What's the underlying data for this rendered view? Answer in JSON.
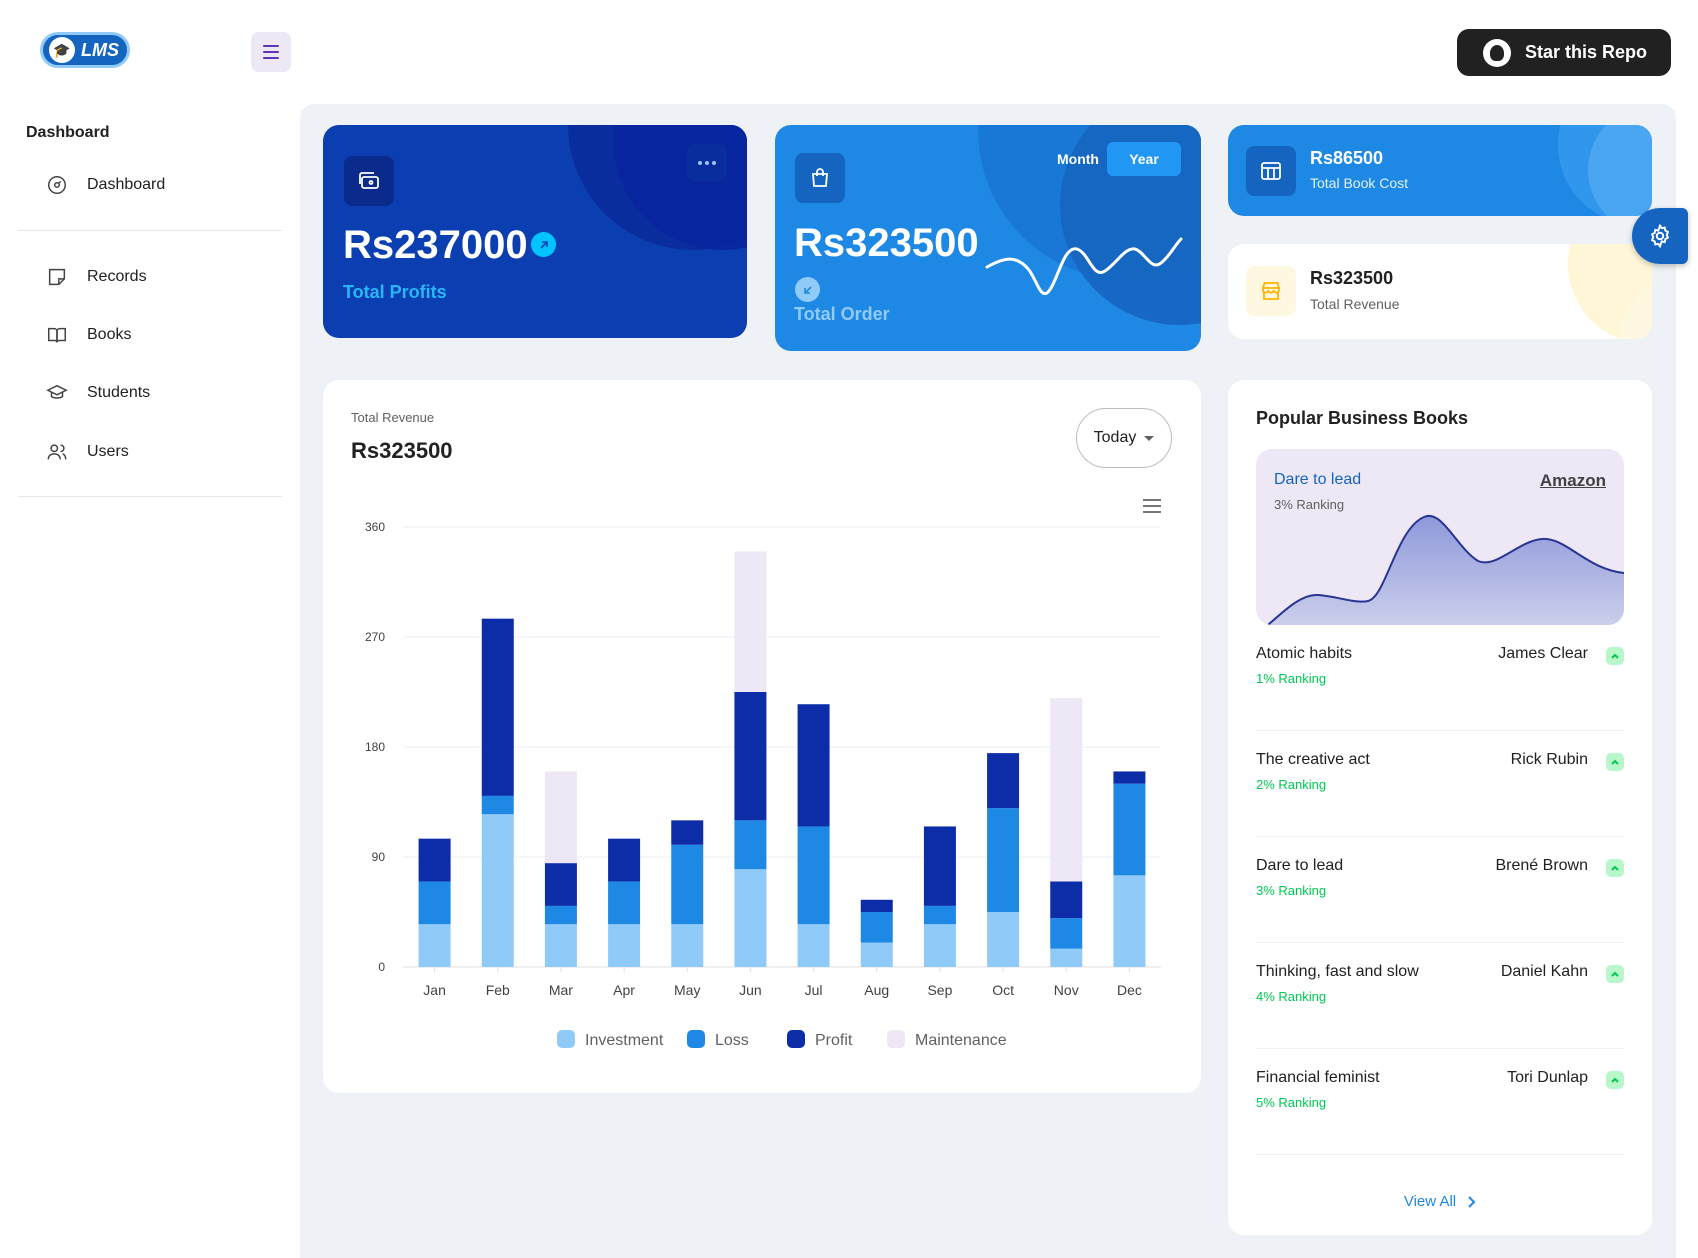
{
  "header": {
    "logo_text": "LMS",
    "star_label": "Star this Repo"
  },
  "sidebar": {
    "caption": "Dashboard",
    "items": [
      {
        "label": "Dashboard",
        "icon": "dashboard-icon"
      },
      {
        "label": "Records",
        "icon": "note-icon"
      },
      {
        "label": "Books",
        "icon": "book-icon"
      },
      {
        "label": "Students",
        "icon": "graduation-cap-icon"
      },
      {
        "label": "Users",
        "icon": "users-icon"
      }
    ]
  },
  "cards": {
    "profits": {
      "value": "Rs237000",
      "label": "Total Profits"
    },
    "orders": {
      "value": "Rs323500",
      "label": "Total Order",
      "toggle_month": "Month",
      "toggle_year": "Year",
      "toggle_selected": "Year"
    },
    "book_cost": {
      "value": "Rs86500",
      "label": "Total Book Cost"
    },
    "revenue": {
      "value": "Rs323500",
      "label": "Total Revenue"
    }
  },
  "revenue_panel": {
    "caption": "Total Revenue",
    "value": "Rs323500",
    "period_select": "Today"
  },
  "chart_data": {
    "type": "bar",
    "stacked": true,
    "categories": [
      "Jan",
      "Feb",
      "Mar",
      "Apr",
      "May",
      "Jun",
      "Jul",
      "Aug",
      "Sep",
      "Oct",
      "Nov",
      "Dec"
    ],
    "series": [
      {
        "name": "Investment",
        "color": "#90caf9",
        "values": [
          35,
          125,
          35,
          35,
          35,
          80,
          35,
          20,
          35,
          45,
          15,
          75
        ]
      },
      {
        "name": "Loss",
        "color": "#1e88e5",
        "values": [
          35,
          15,
          15,
          35,
          65,
          40,
          80,
          25,
          15,
          85,
          25,
          75
        ]
      },
      {
        "name": "Profit",
        "color": "#0d2da8",
        "values": [
          35,
          145,
          35,
          35,
          20,
          105,
          100,
          10,
          65,
          45,
          30,
          10
        ]
      },
      {
        "name": "Maintenance",
        "color": "#ede7f6",
        "values": [
          0,
          0,
          75,
          0,
          0,
          115,
          0,
          0,
          0,
          0,
          150,
          0
        ]
      }
    ],
    "yticks": [
      0,
      90,
      180,
      270,
      360
    ],
    "ylim": [
      0,
      360
    ],
    "grid": true,
    "legend": "bottom-center"
  },
  "popular": {
    "title": "Popular Business Books",
    "featured": {
      "title": "Dare to lead",
      "ranking": "3% Ranking",
      "source": "Amazon"
    },
    "books": [
      {
        "title": "Atomic habits",
        "author": "James Clear",
        "ranking": "1% Ranking"
      },
      {
        "title": "The creative act",
        "author": "Rick Rubin",
        "ranking": "2% Ranking"
      },
      {
        "title": "Dare to lead",
        "author": "Brené Brown",
        "ranking": "3% Ranking"
      },
      {
        "title": "Thinking, fast and slow",
        "author": "Daniel Kahn",
        "ranking": "4% Ranking"
      },
      {
        "title": "Financial feminist",
        "author": "Tori Dunlap",
        "ranking": "5% Ranking"
      }
    ],
    "view_all": "View All"
  }
}
